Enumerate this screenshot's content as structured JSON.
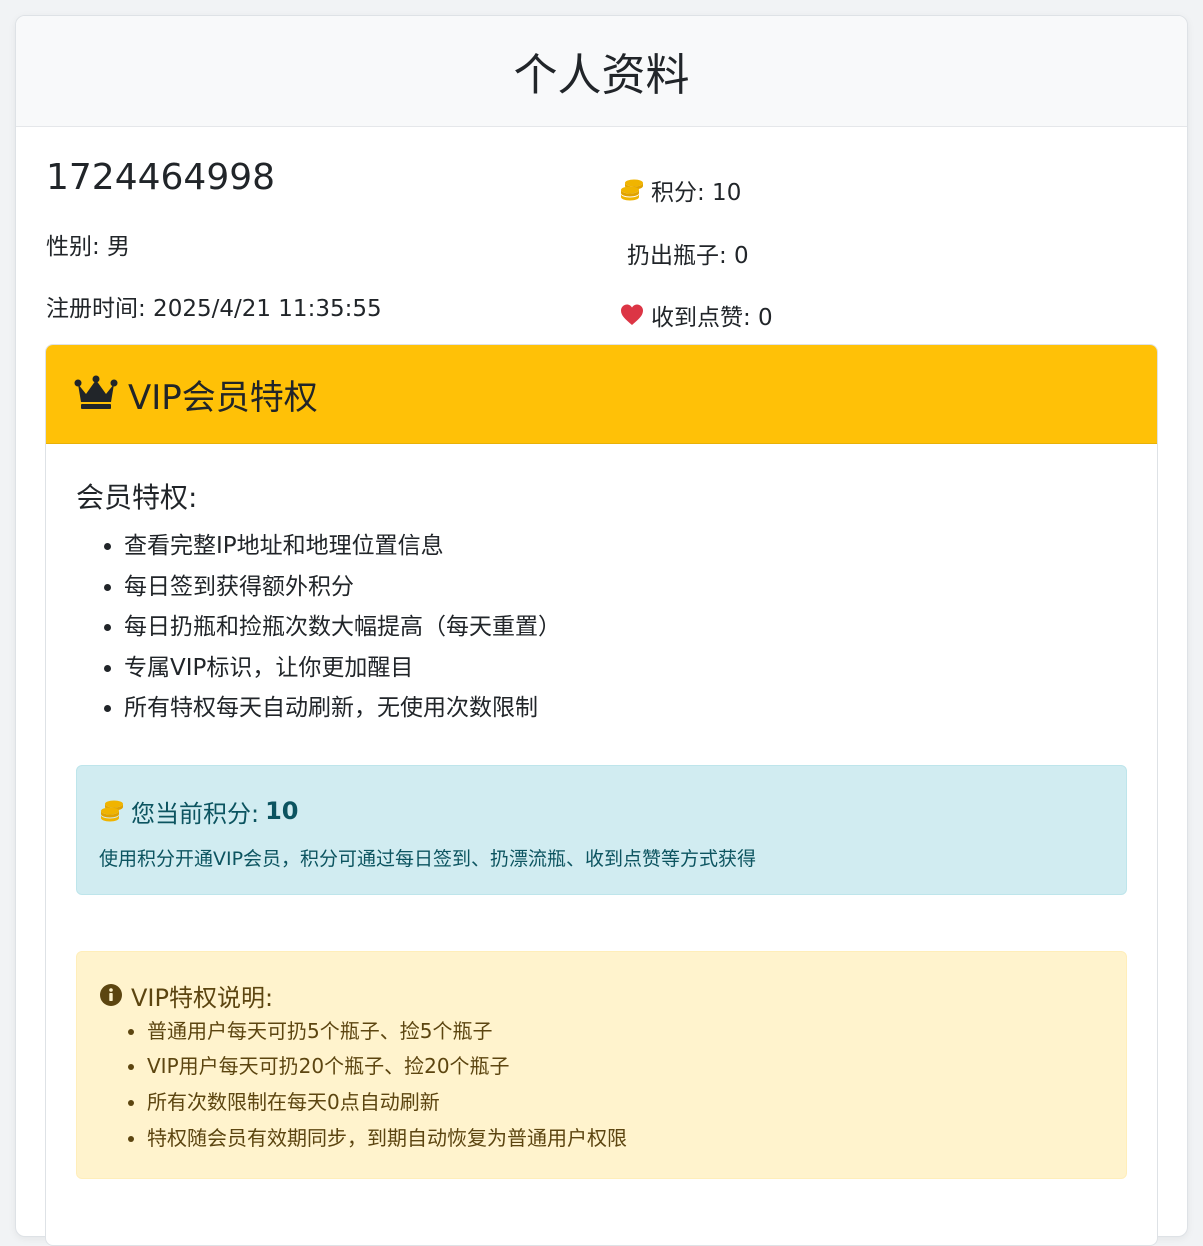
{
  "header": {
    "title": "个人资料"
  },
  "profile": {
    "user_id": "1724464998",
    "gender": "性别: 男",
    "registered": "注册时间: 2025/4/21 11:35:55",
    "points": "积分: 10",
    "thrown": "扔出瓶子: 0",
    "likes": "收到点赞: 0"
  },
  "vip": {
    "title": "VIP会员特权",
    "subtitle": "会员特权:",
    "privileges": [
      "查看完整IP地址和地理位置信息",
      "每日签到获得额外积分",
      "每日扔瓶和捡瓶次数大幅提高（每天重置）",
      "专属VIP标识，让你更加醒目",
      "所有特权每天自动刷新，无使用次数限制"
    ],
    "info": {
      "points_label": "您当前积分:",
      "points_value": "10",
      "hint": "使用积分开通VIP会员，积分可通过每日签到、扔漂流瓶、收到点赞等方式获得"
    },
    "notes": {
      "title": "VIP特权说明:",
      "items": [
        "普通用户每天可扔5个瓶子、捡5个瓶子",
        "VIP用户每天可扔20个瓶子、捡20个瓶子",
        "所有次数限制在每天0点自动刷新",
        "特权随会员有效期同步，到期自动恢复为普通用户权限"
      ]
    }
  },
  "colors": {
    "vip_header": "#ffc107",
    "info_bg": "#d1ecf1",
    "warn_bg": "#fff3cd",
    "heart": "#dc3545",
    "coins": "#f0b400"
  }
}
